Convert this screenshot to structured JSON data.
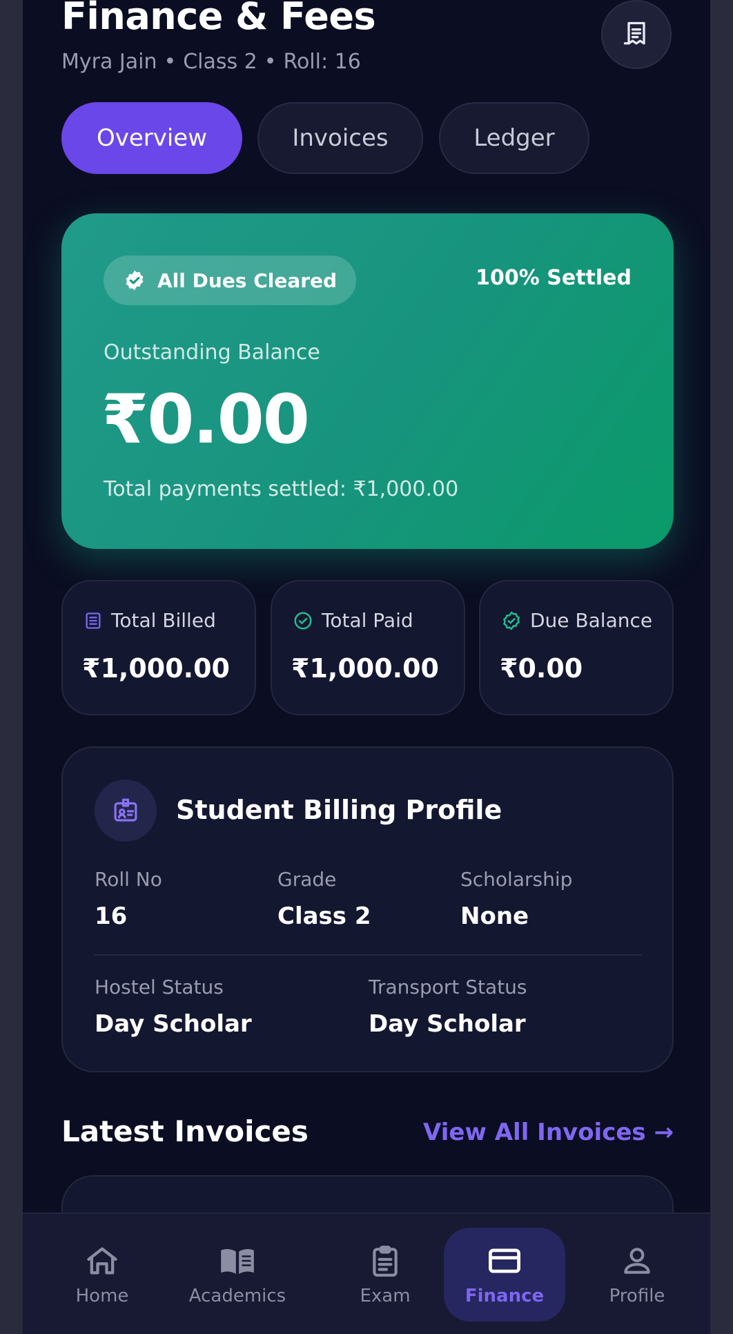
{
  "header": {
    "title": "Finance & Fees",
    "student_name": "Myra Jain",
    "student_class": "Class 2",
    "roll": "Roll: 16",
    "separator": "•"
  },
  "tabs": [
    {
      "label": "Overview",
      "active": true
    },
    {
      "label": "Invoices",
      "active": false
    },
    {
      "label": "Ledger",
      "active": false
    }
  ],
  "hero": {
    "badge": "All Dues Cleared",
    "settled": "100% Settled",
    "label": "Outstanding Balance",
    "amount": "₹0.00",
    "footnote": "Total payments settled: ₹1,000.00"
  },
  "stats": [
    {
      "label": "Total Billed",
      "value": "₹1,000.00",
      "icon": "document-icon"
    },
    {
      "label": "Total Paid",
      "value": "₹1,000.00",
      "icon": "check-circle-icon"
    },
    {
      "label": "Due Balance",
      "value": "₹0.00",
      "icon": "verified-badge-icon"
    }
  ],
  "profile": {
    "title": "Student Billing Profile",
    "fields": {
      "roll_label": "Roll No",
      "roll_value": "16",
      "grade_label": "Grade",
      "grade_value": "Class 2",
      "scholarship_label": "Scholarship",
      "scholarship_value": "None",
      "hostel_label": "Hostel Status",
      "hostel_value": "Day Scholar",
      "transport_label": "Transport Status",
      "transport_value": "Day Scholar"
    }
  },
  "invoices": {
    "title": "Latest Invoices",
    "view_all": "View All Invoices →"
  },
  "nav": [
    {
      "label": "Home",
      "icon": "home-icon",
      "active": false
    },
    {
      "label": "Academics",
      "icon": "book-icon",
      "active": false
    },
    {
      "label": "Exam",
      "icon": "clipboard-icon",
      "active": false
    },
    {
      "label": "Finance",
      "icon": "credit-card-icon",
      "active": true
    },
    {
      "label": "Profile",
      "icon": "user-icon",
      "active": false
    }
  ],
  "colors": {
    "accent": "#6a47e8",
    "hero_green": "#17947d",
    "background": "#0b0e22",
    "link": "#8067f2"
  }
}
